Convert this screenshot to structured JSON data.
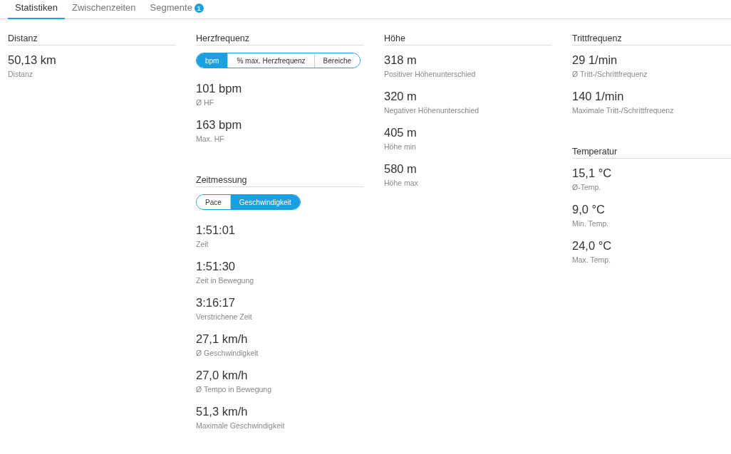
{
  "tabs": [
    {
      "label": "Statistiken",
      "selected": true
    },
    {
      "label": "Zwischenzeiten",
      "selected": false
    },
    {
      "label": "Segmente",
      "selected": false,
      "badge": "1"
    }
  ],
  "columns": [
    {
      "sections": [
        {
          "title": "Distanz",
          "stats": [
            {
              "value": "50,13 km",
              "label": "Distanz"
            }
          ]
        }
      ]
    },
    {
      "sections": [
        {
          "title": "Herzfrequenz",
          "toggle": [
            {
              "label": "bpm",
              "selected": true
            },
            {
              "label": "% max. Herzfrequenz",
              "selected": false
            },
            {
              "label": "Bereiche",
              "selected": false
            }
          ],
          "stats": [
            {
              "value": "101 bpm",
              "label": "Ø HF"
            },
            {
              "value": "163 bpm",
              "label": "Max. HF"
            }
          ]
        },
        {
          "title": "Zeitmessung",
          "toggle": [
            {
              "label": "Pace",
              "selected": false
            },
            {
              "label": "Geschwindigkeit",
              "selected": true
            }
          ],
          "stats": [
            {
              "value": "1:51:01",
              "label": "Zeit"
            },
            {
              "value": "1:51:30",
              "label": "Zeit in Bewegung"
            },
            {
              "value": "3:16:17",
              "label": "Verstrichene Zeit"
            },
            {
              "value": "27,1 km/h",
              "label": "Ø Geschwindigkeit"
            },
            {
              "value": "27,0 km/h",
              "label": "Ø Tempo in Bewegung"
            },
            {
              "value": "51,3 km/h",
              "label": "Maximale Geschwindigkeit"
            }
          ]
        }
      ]
    },
    {
      "sections": [
        {
          "title": "Höhe",
          "stats": [
            {
              "value": "318 m",
              "label": "Positiver Höhenunterschied"
            },
            {
              "value": "320 m",
              "label": "Negativer Höhenunterschied"
            },
            {
              "value": "405 m",
              "label": "Höhe min"
            },
            {
              "value": "580 m",
              "label": "Höhe max"
            }
          ]
        }
      ]
    },
    {
      "sections": [
        {
          "title": "Trittfrequenz",
          "stats": [
            {
              "value": "29 1/min",
              "label": "Ø Tritt-/Schrittfrequenz"
            },
            {
              "value": "140 1/min",
              "label": "Maximale Tritt-/Schrittfrequenz"
            }
          ]
        },
        {
          "title": "Temperatur",
          "stats": [
            {
              "value": "15,1 °C",
              "label": "Ø-Temp."
            },
            {
              "value": "9,0 °C",
              "label": "Min. Temp."
            },
            {
              "value": "24,0 °C",
              "label": "Max. Temp."
            }
          ]
        }
      ]
    }
  ]
}
